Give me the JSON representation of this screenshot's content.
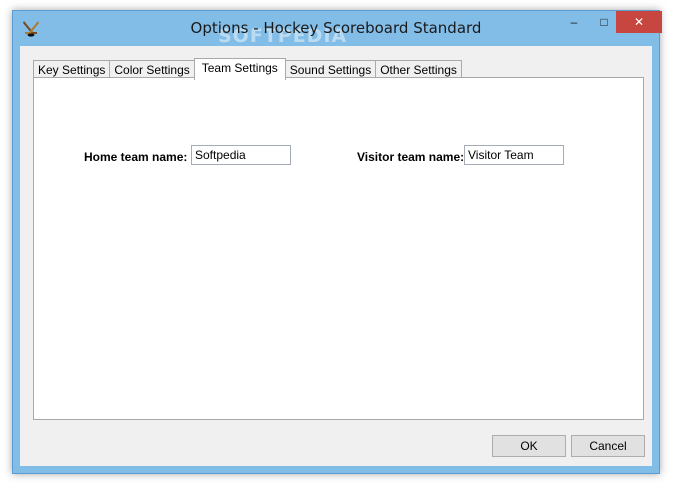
{
  "window": {
    "title": "Options - Hockey Scoreboard Standard",
    "watermark": "SOFTPEDIA",
    "minimize_glyph": "–",
    "maximize_glyph": "□",
    "close_glyph": "✕",
    "app_icon": "hockey-sticks-icon"
  },
  "tabs": [
    {
      "label": "Key Settings",
      "active": false
    },
    {
      "label": "Color Settings",
      "active": false
    },
    {
      "label": "Team Settings",
      "active": true
    },
    {
      "label": "Sound Settings",
      "active": false
    },
    {
      "label": "Other Settings",
      "active": false
    }
  ],
  "team_settings": {
    "home_label": "Home team name:",
    "home_value": "Softpedia",
    "visitor_label": "Visitor team name:",
    "visitor_value": "Visitor Team"
  },
  "buttons": {
    "ok": "OK",
    "cancel": "Cancel"
  },
  "colors": {
    "frame": "#82bde8",
    "close_button": "#c7463f",
    "dialog_background": "#f0f0f0"
  }
}
